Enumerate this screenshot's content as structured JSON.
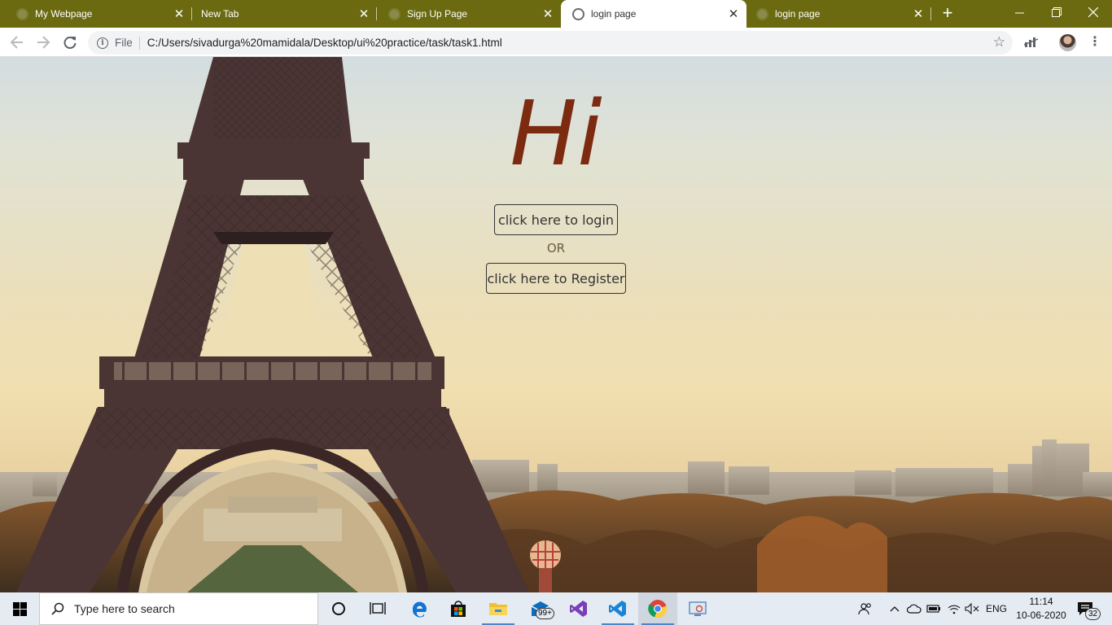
{
  "browser": {
    "tabs": [
      {
        "title": "My Webpage",
        "active": false
      },
      {
        "title": "New Tab",
        "active": false
      },
      {
        "title": "Sign Up Page",
        "active": false
      },
      {
        "title": "login page",
        "active": true
      },
      {
        "title": "login page",
        "active": false
      }
    ],
    "new_tab_symbol": "+",
    "address": {
      "scheme_label": "File",
      "url": "C:/Users/sivadurga%20mamidala/Desktop/ui%20practice/task/task1.html"
    }
  },
  "page": {
    "heading": "Hi",
    "login_button": "click here to login",
    "or_text": "OR",
    "register_button": "click here to Register",
    "heading_color": "#7c2a10"
  },
  "taskbar": {
    "search_placeholder": "Type here to search",
    "mail_badge": "99+",
    "language": "ENG",
    "time": "11:14",
    "date": "10-06-2020",
    "notification_count": "32"
  },
  "colors": {
    "tabstrip": "#6b6a10",
    "taskbar": "#e5ebf3"
  }
}
